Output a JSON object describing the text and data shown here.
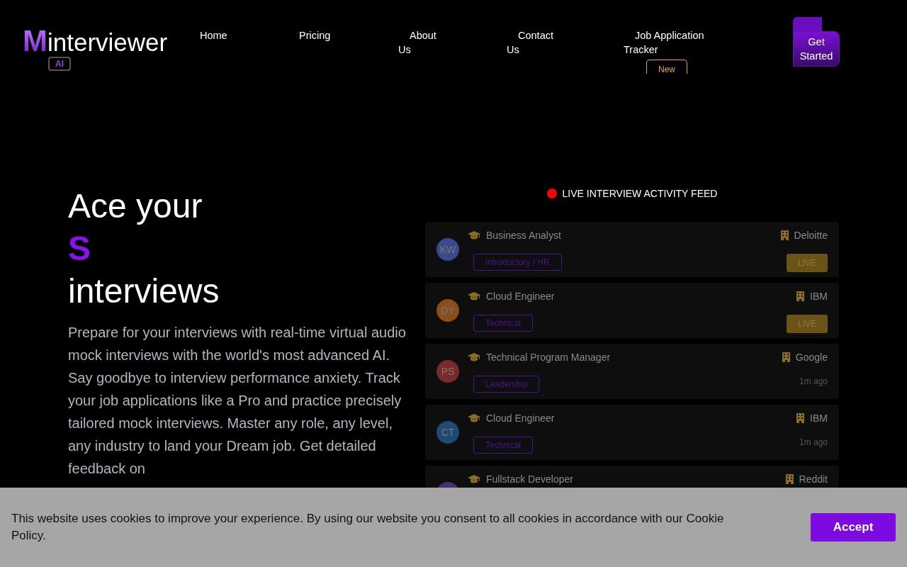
{
  "logo": {
    "mark": "M",
    "word": "interviewer",
    "badge": "AI"
  },
  "nav": [
    {
      "label": "Home"
    },
    {
      "label": "Pricing"
    },
    {
      "label": "About Us"
    },
    {
      "label": "Contact Us"
    },
    {
      "label": "Job Application Tracker",
      "badge": "New"
    }
  ],
  "cta": "Get Started",
  "hero": {
    "lines": [
      "Ace your",
      "S",
      "interviews"
    ],
    "text": "Prepare for your interviews with real-time virtual audio mock interviews with the world's most advanced AI. Say goodbye to interview performance anxiety. Track your job applications like a Pro and practice precisely tailored mock interviews. Master any role, any level, any industry to land your Dream job. Get detailed feedback on"
  },
  "feed": {
    "title": "LIVE INTERVIEW ACTIVITY FEED",
    "items": [
      {
        "initials": "KW",
        "color": "#3b4a8f",
        "role": "Business Analyst",
        "company": "Deloitte",
        "tag": "Introductory / HR",
        "status": {
          "kind": "live",
          "text": "LIVE"
        }
      },
      {
        "initials": "DY",
        "color": "#8a4e1a",
        "role": "Cloud Engineer",
        "company": "IBM",
        "tag": "Technical",
        "status": {
          "kind": "live",
          "text": "LIVE"
        }
      },
      {
        "initials": "PS",
        "color": "#7a2a2a",
        "role": "Technical Program Manager",
        "company": "Google",
        "tag": "Leadership",
        "status": {
          "kind": "time",
          "text": "1m ago"
        }
      },
      {
        "initials": "CT",
        "color": "#1e4a73",
        "role": "Cloud Engineer",
        "company": "IBM",
        "tag": "Technical",
        "status": {
          "kind": "time",
          "text": "1m ago"
        }
      },
      {
        "color": "#4a2f78",
        "role": "Fullstack Developer",
        "company": "Reddit"
      }
    ]
  },
  "cookie": {
    "text": "This website uses cookies to improve your experience. By using our website you consent to all cookies in accordance with our Cookie Policy.",
    "button": "Accept"
  }
}
